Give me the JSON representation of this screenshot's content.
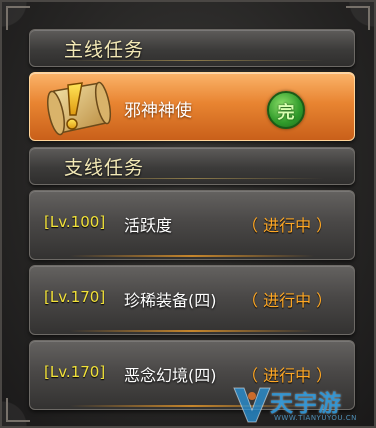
{
  "sections": {
    "main": {
      "title": "主线任务"
    },
    "side": {
      "title": "支线任务"
    }
  },
  "main_quest": {
    "name": "邪神神使",
    "icon": "scroll-exclamation-icon",
    "status_icon": "completed-badge-icon",
    "status_glyph": "完"
  },
  "side_quests": [
    {
      "level": "[Lv.100]",
      "name": "活跃度",
      "status": "（ 进行中 ）"
    },
    {
      "level": "[Lv.170]",
      "name": "珍稀装备(四)",
      "status": "（ 进行中 ）"
    },
    {
      "level": "[Lv.170]",
      "name": "恶念幻境(四)",
      "status": "（ 进行中 ）"
    }
  ],
  "watermark": {
    "brand": "天宇游",
    "url": "WWW.TIANYUYOU.CN"
  },
  "colors": {
    "level": "#f2e23a",
    "status": "#ffa825",
    "header_text": "#f3e9b6",
    "selected_row": "#e88431"
  }
}
